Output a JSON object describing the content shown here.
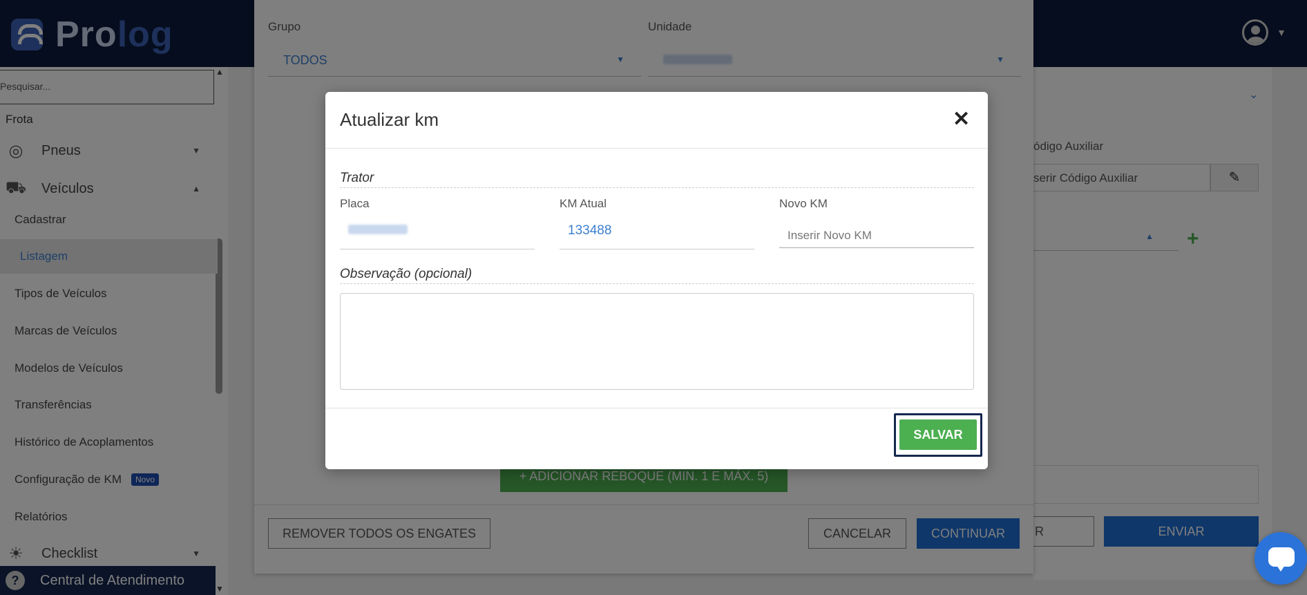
{
  "app": {
    "logo_pro": "Pro",
    "logo_log": "log"
  },
  "sidebar": {
    "search_placeholder": "Pesquisar...",
    "section": "Frota",
    "menus": [
      {
        "label": "Pneus",
        "icon": "tire-icon"
      },
      {
        "label": "Veículos",
        "icon": "truck-icon"
      },
      {
        "label": "Checklist",
        "icon": "checklist-icon"
      }
    ],
    "items": [
      "Cadastrar",
      "Listagem",
      "Tipos de Veículos",
      "Marcas de Veículos",
      "Modelos de Veículos",
      "Transferências",
      "Histórico de Acoplamentos",
      "Configuração de KM",
      "Relatórios"
    ],
    "badge_new": "Novo",
    "help": "Central de Atendimento"
  },
  "background": {
    "grupo_label": "Grupo",
    "grupo_value": "TODOS",
    "unidade_label": "Unidade",
    "add_trailer": "+ ADICIONAR REBOQUE (MIN. 1 E MÁX. 5)",
    "remove_all": "REMOVER TODOS OS ENGATES",
    "cancel": "CANCELAR",
    "continue": "CONTINUAR"
  },
  "right_panel": {
    "codigo_label": "ódigo Auxiliar",
    "codigo_placeholder": "serir Código Auxiliar",
    "btn_r": "R",
    "btn_enviar": "ENVIAR"
  },
  "modal": {
    "title": "Atualizar km",
    "close": "✕",
    "section_trator": "Trator",
    "placa_label": "Placa",
    "km_atual_label": "KM Atual",
    "km_atual_value": "133488",
    "novo_km_label": "Novo KM",
    "novo_km_placeholder": "Inserir Novo KM",
    "obs_label": "Observação (opcional)",
    "save": "SALVAR"
  },
  "colors": {
    "header_bg": "#0c1a3c",
    "accent_blue": "#1f6ed4",
    "success_green": "#4caf50",
    "link_blue": "#3c7fd0"
  }
}
